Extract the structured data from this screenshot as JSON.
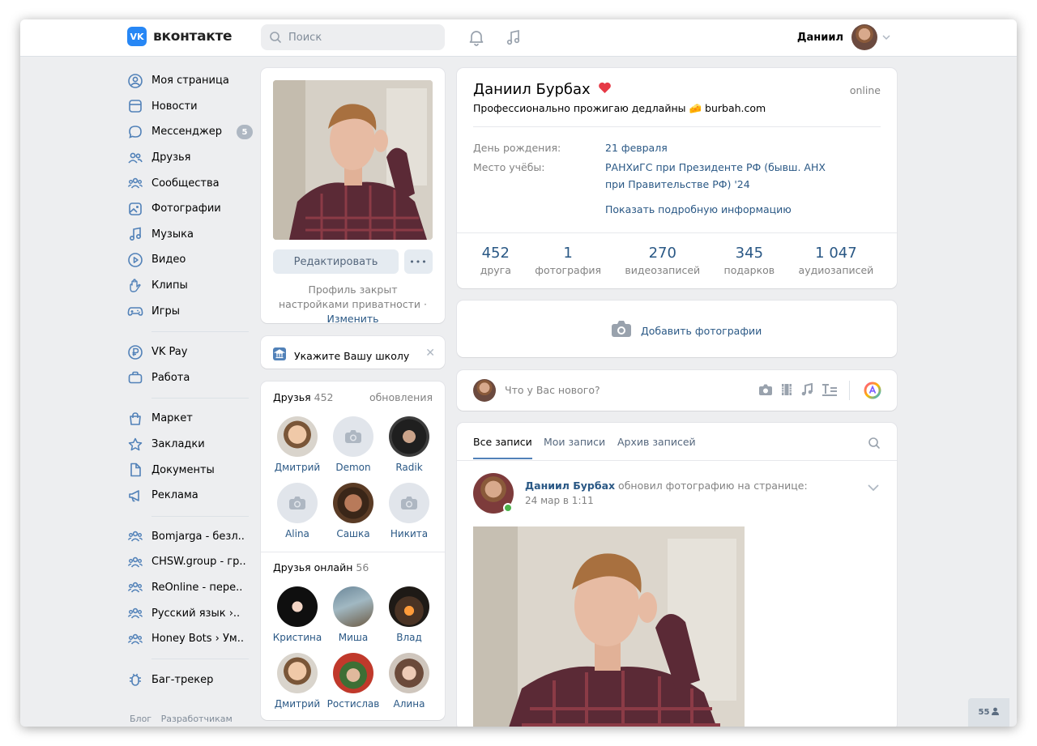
{
  "header": {
    "logo_mark": "VK",
    "logo_text": "вконтакте",
    "search_placeholder": "Поиск",
    "user_name": "Даниил"
  },
  "sidebar": {
    "items": [
      {
        "label": "Моя страница",
        "icon": "user-circle-icon"
      },
      {
        "label": "Новости",
        "icon": "newsfeed-icon"
      },
      {
        "label": "Мессенджер",
        "icon": "message-icon",
        "badge": "5"
      },
      {
        "label": "Друзья",
        "icon": "friends-icon"
      },
      {
        "label": "Сообщества",
        "icon": "groups-icon"
      },
      {
        "label": "Фотографии",
        "icon": "photo-icon"
      },
      {
        "label": "Музыка",
        "icon": "music-icon"
      },
      {
        "label": "Видео",
        "icon": "video-icon"
      },
      {
        "label": "Клипы",
        "icon": "clips-icon"
      },
      {
        "label": "Игры",
        "icon": "gamepad-icon"
      },
      {
        "label": "VK Pay",
        "icon": "vkpay-icon"
      },
      {
        "label": "Работа",
        "icon": "work-icon"
      },
      {
        "label": "Маркет",
        "icon": "market-icon"
      },
      {
        "label": "Закладки",
        "icon": "star-icon"
      },
      {
        "label": "Документы",
        "icon": "document-icon"
      },
      {
        "label": "Реклама",
        "icon": "ads-icon"
      },
      {
        "label": "Bomjarga - безл..",
        "icon": "groups-icon"
      },
      {
        "label": "CHSW.group - гр..",
        "icon": "groups-icon"
      },
      {
        "label": "ReOnline - пере..",
        "icon": "groups-icon"
      },
      {
        "label": "Русский язык ›..",
        "icon": "groups-icon"
      },
      {
        "label": "Honey Bots › Ум..",
        "icon": "groups-icon"
      },
      {
        "label": "Баг-трекер",
        "icon": "bug-icon"
      }
    ],
    "footer": [
      "Блог",
      "Разработчикам"
    ]
  },
  "avatar_card": {
    "edit_button": "Редактировать",
    "more_button": "•••",
    "private_text": "Профиль закрыт настройками приватности",
    "private_sep": " · ",
    "private_link": "Изменить"
  },
  "school_card": {
    "label": "Укажите Вашу школу",
    "close": "✕"
  },
  "friends": {
    "title": "Друзья",
    "count": "452",
    "updates_link": "обновления",
    "items": [
      "Дмитрий",
      "Demon",
      "Radik",
      "Alina",
      "Сашка",
      "Никита"
    ],
    "online_title": "Друзья онлайн",
    "online_count": "56",
    "online_items": [
      "Кристина",
      "Миша",
      "Влад",
      "Дмитрий",
      "Ростислав",
      "Алина"
    ]
  },
  "profile": {
    "name": "Даниил Бурбах",
    "status": "Профессионально прожигаю дедлайны 🧀 burbah.com",
    "online": "online",
    "birthday_label": "День рождения:",
    "birthday_value": "21 февраля",
    "study_label": "Место учёбы:",
    "study_value": "РАНХиГС при Президенте РФ (бывш. АНХ при Правительстве РФ) '24",
    "more_info": "Показать подробную информацию",
    "counters": [
      {
        "num": "452",
        "label": "друга"
      },
      {
        "num": "1",
        "label": "фотография"
      },
      {
        "num": "270",
        "label": "видеозаписей"
      },
      {
        "num": "345",
        "label": "подарков"
      },
      {
        "num": "1 047",
        "label": "аудиозаписей"
      }
    ]
  },
  "add_photo": {
    "label": "Добавить фотографии"
  },
  "composer": {
    "placeholder": "Что у Вас нового?"
  },
  "wall": {
    "tabs": [
      "Все записи",
      "Мои записи",
      "Архив записей"
    ],
    "post_author": "Даниил Бурбах",
    "post_action": " обновил фотографию на странице:",
    "post_time": "24 мар в 1:11"
  },
  "online_widget": {
    "count": "55"
  },
  "colors": {
    "accent": "#2787f5",
    "link": "#2a5885",
    "background": "#edeef0",
    "online": "#4bb34b"
  }
}
